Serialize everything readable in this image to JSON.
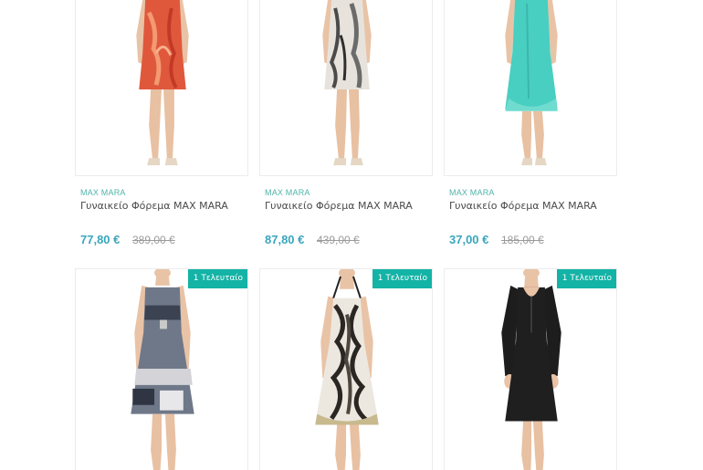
{
  "products": [
    {
      "brand": "MAX MARA",
      "title": "Γυναικείο Φόρεμα MAX MARA",
      "price": "77,80 €",
      "old_price": "389,00 €",
      "dress": "red-floral-dress"
    },
    {
      "brand": "MAX MARA",
      "title": "Γυναικείο Φόρεμα MAX MARA",
      "price": "87,80 €",
      "old_price": "439,00 €",
      "dress": "grey-print-dress"
    },
    {
      "brand": "MAX MARA",
      "title": "Γυναικείο Φόρεμα MAX MARA",
      "price": "37,00 €",
      "old_price": "185,00 €",
      "dress": "turquoise-dress"
    },
    {
      "badge": "1 Τελευταίο",
      "dress": "navy-print-sundress"
    },
    {
      "badge": "1 Τελευταίο",
      "dress": "black-white-halter-dress"
    },
    {
      "badge": "1 Τελευταίο",
      "dress": "black-long-sleeve-dress"
    }
  ],
  "colors": {
    "accent": "#13b3a6",
    "brand_text": "#4fb4a8",
    "price": "#3aa6bd",
    "old_price": "#9b9b9b"
  }
}
